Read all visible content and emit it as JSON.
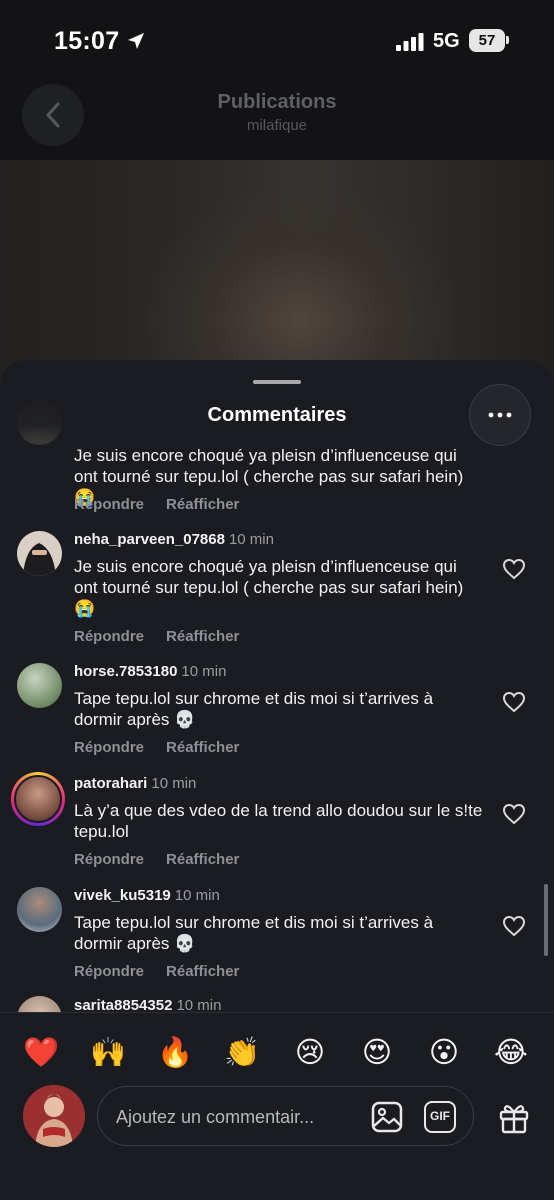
{
  "status_bar": {
    "time": "15:07",
    "network": "5G",
    "battery": "57"
  },
  "header": {
    "title": "Publications",
    "subtitle": "milafique"
  },
  "sheet": {
    "title": "Commentaires"
  },
  "comments": [
    {
      "username": "",
      "time": "",
      "text": "Je suis encore choqué ya pleisn d’influenceuse qui ont tourné sur tepu.lol ( cherche pas sur safari hein) 😭",
      "reply_label": "Répondre",
      "repost_label": "Réafficher"
    },
    {
      "username": "neha_parveen_07868",
      "time": "10 min",
      "text": "Je suis encore choqué ya pleisn d’influenceuse qui ont tourné sur tepu.lol ( cherche pas sur safari hein) 😭",
      "reply_label": "Répondre",
      "repost_label": "Réafficher"
    },
    {
      "username": "horse.7853180",
      "time": "10 min",
      "text": "Tape tepu.lol sur chrome et dis moi si t’arrives à dormir après 💀",
      "reply_label": "Répondre",
      "repost_label": "Réafficher"
    },
    {
      "username": "patorahari",
      "time": "10 min",
      "text": "Là y’a que des vdeo de la trend allo doudou sur le s!te  tepu.lol",
      "reply_label": "Répondre",
      "repost_label": "Réafficher"
    },
    {
      "username": "vivek_ku5319",
      "time": "10 min",
      "text": "Tape tepu.lol sur chrome et dis moi si t’arrives à dormir après 💀",
      "reply_label": "Répondre",
      "repost_label": "Réafficher"
    },
    {
      "username": "sarita8854352",
      "time": "10 min"
    }
  ],
  "reactions": [
    "❤️",
    "🙌",
    "🔥",
    "👏",
    "😢",
    "😍",
    "😮",
    "😂"
  ],
  "composer": {
    "placeholder": "Ajoutez un commentair...",
    "gif_label": "GIF"
  },
  "icons": {
    "back": "chevron-left-icon",
    "more": "more-horizontal-icon",
    "like": "heart-outline-icon",
    "image": "image-icon",
    "gif": "gif-icon",
    "gift": "gift-icon",
    "location": "location-arrow-icon",
    "signal": "signal-bars-icon"
  },
  "colors": {
    "sheet_bg": "#1b1c21",
    "action_text": "#8e9096",
    "muted_text": "#9a9ca2"
  }
}
